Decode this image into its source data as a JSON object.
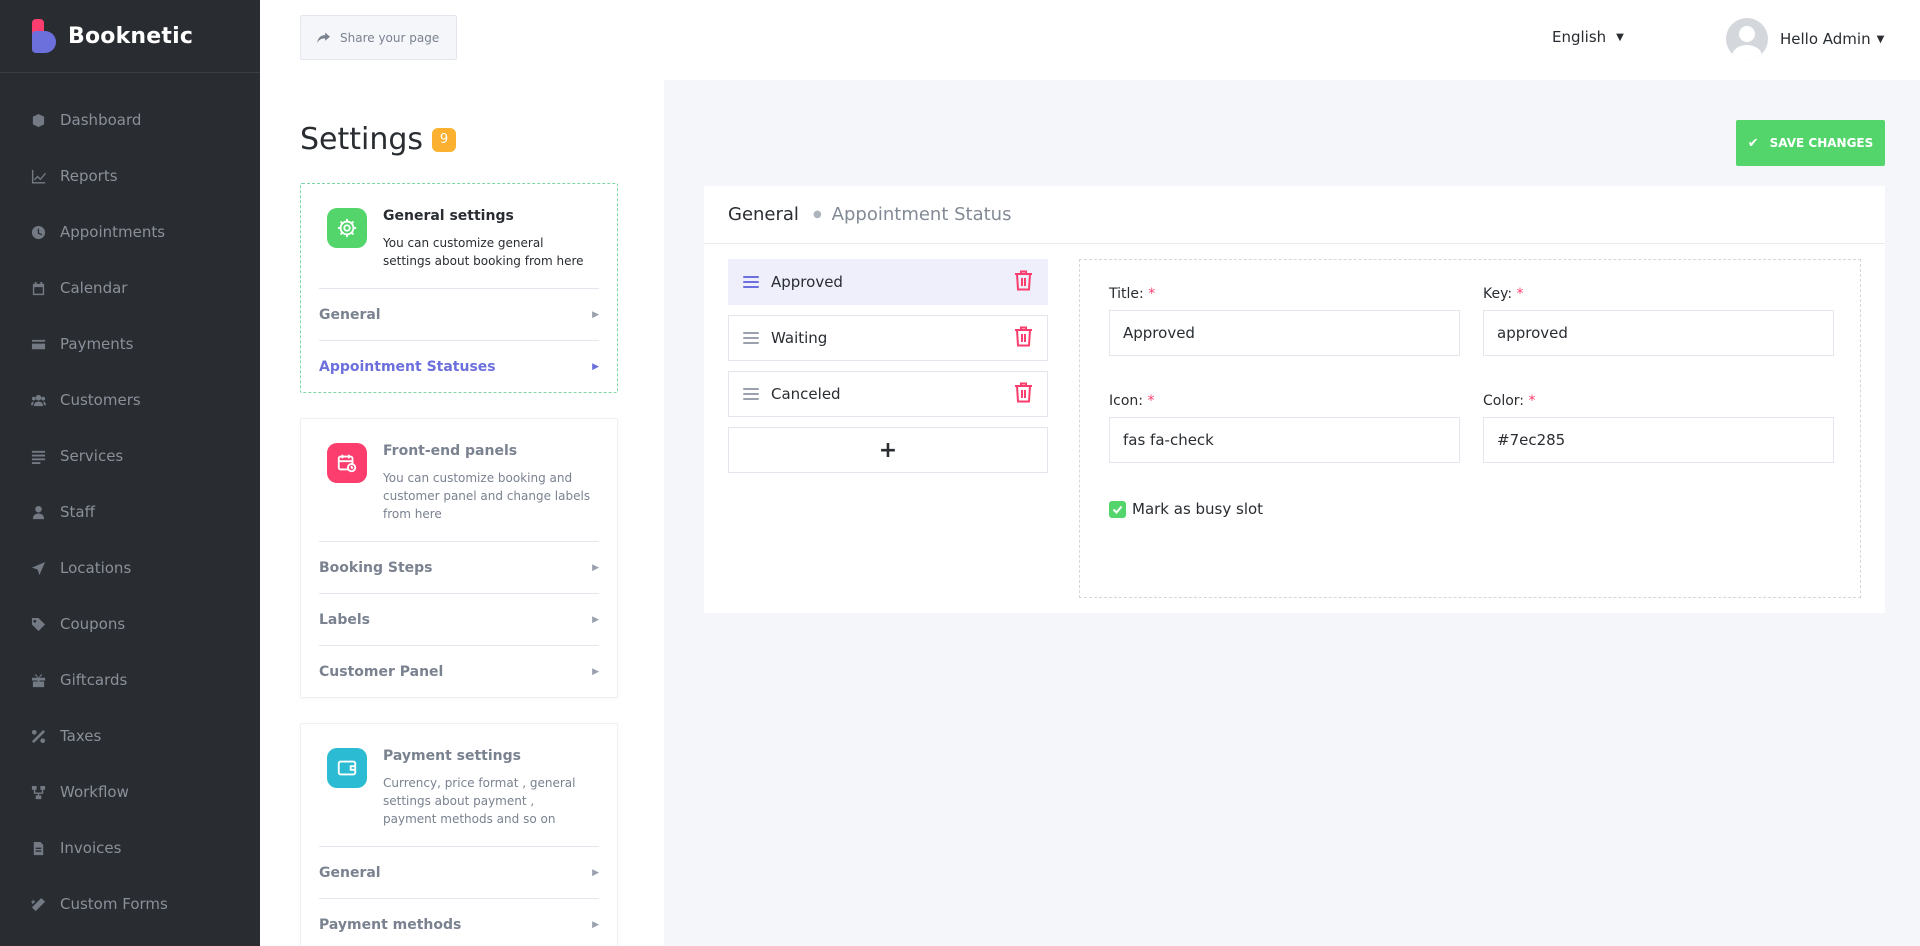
{
  "brand": {
    "name": "Booknetic"
  },
  "sidebar": {
    "items": [
      {
        "label": "Dashboard",
        "icon": "dashboard-icon"
      },
      {
        "label": "Reports",
        "icon": "chart-line-icon"
      },
      {
        "label": "Appointments",
        "icon": "clock-icon"
      },
      {
        "label": "Calendar",
        "icon": "calendar-icon"
      },
      {
        "label": "Payments",
        "icon": "credit-card-icon"
      },
      {
        "label": "Customers",
        "icon": "users-icon"
      },
      {
        "label": "Services",
        "icon": "list-icon"
      },
      {
        "label": "Staff",
        "icon": "user-icon"
      },
      {
        "label": "Locations",
        "icon": "location-arrow-icon"
      },
      {
        "label": "Coupons",
        "icon": "tag-icon"
      },
      {
        "label": "Giftcards",
        "icon": "gift-icon"
      },
      {
        "label": "Taxes",
        "icon": "percent-icon"
      },
      {
        "label": "Workflow",
        "icon": "workflow-icon"
      },
      {
        "label": "Invoices",
        "icon": "file-icon"
      },
      {
        "label": "Custom Forms",
        "icon": "magic-wand-icon"
      }
    ]
  },
  "topbar": {
    "share_label": "Share your page",
    "language": "English",
    "user_greeting": "Hello Admin"
  },
  "settings": {
    "title": "Settings",
    "badge": "9",
    "groups": [
      {
        "name": "General settings",
        "desc": "You can customize general settings about booking from here",
        "icon": "gear-icon",
        "color": "#53d56c",
        "items": [
          "General",
          "Appointment Statuses"
        ]
      },
      {
        "name": "Front-end panels",
        "desc": "You can customize booking and customer panel and change labels from here",
        "icon": "calendar-clock-icon",
        "color": "#fb3e6e",
        "items": [
          "Booking Steps",
          "Labels",
          "Customer Panel"
        ]
      },
      {
        "name": "Payment settings",
        "desc": "Currency, price format , general settings about payment , payment methods and so on",
        "icon": "wallet-icon",
        "color": "#2bbbd2",
        "items": [
          "General",
          "Payment methods"
        ]
      }
    ]
  },
  "main": {
    "save_label": "SAVE CHANGES",
    "breadcrumb": {
      "root": "General",
      "current": "Appointment Status"
    },
    "statuses": [
      "Approved",
      "Waiting",
      "Canceled"
    ],
    "add_label": "+",
    "form": {
      "title_label": "Title:",
      "title_value": "Approved",
      "key_label": "Key:",
      "key_value": "approved",
      "icon_label": "Icon:",
      "icon_value": "fas fa-check",
      "color_label": "Color:",
      "color_value": "#7ec285",
      "busy_label": "Mark as busy slot",
      "busy_checked": true,
      "required_mark": "*"
    }
  },
  "colors": {
    "accent": "#6c70dc",
    "success": "#53d56c",
    "danger": "#fb3e6e",
    "badge": "#fbb02f",
    "sidebar_bg": "#292d32"
  }
}
